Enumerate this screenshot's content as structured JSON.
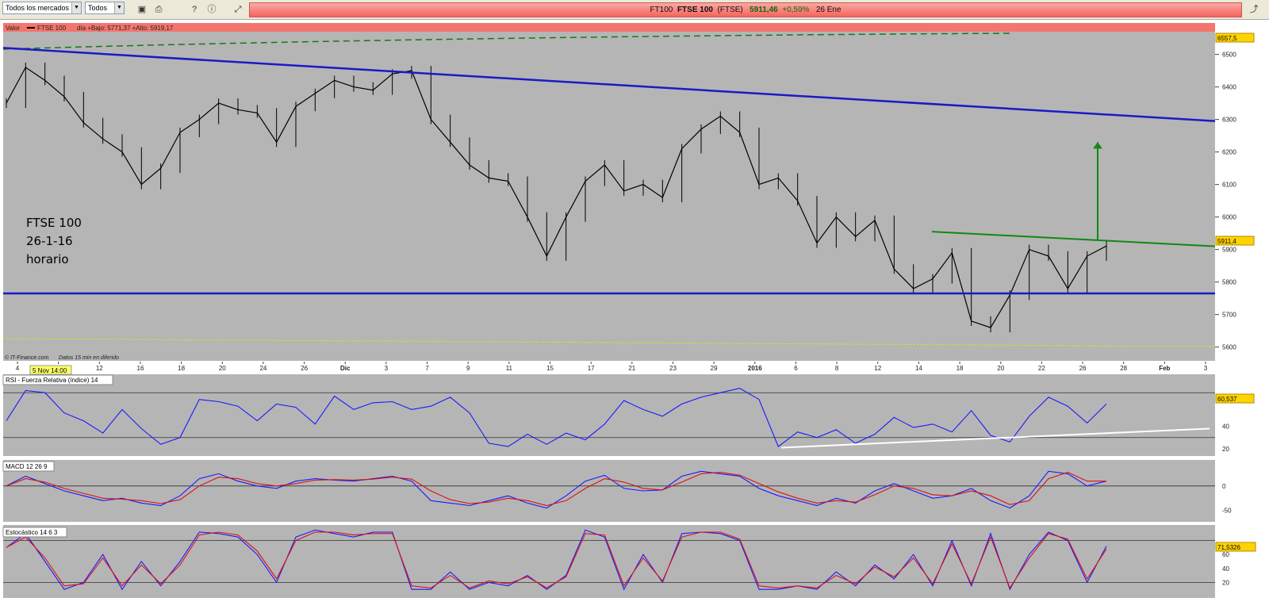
{
  "toolbar": {
    "market_select": "Todos los mercados",
    "type_select": "Todos",
    "ticker": {
      "code": "FT100",
      "name": "FTSE 100",
      "symbol": "(FTSE)",
      "price": "5911,46",
      "change": "+0,59%",
      "date": "26 Ene"
    }
  },
  "main_panel": {
    "legend": "Valor",
    "series_name": "FTSE 100",
    "day_range": "día +Bajo: 5771,37 +Alto: 5919,17",
    "annotation": [
      "FTSE 100",
      "26-1-16",
      "horario"
    ],
    "source": "© IT-Finance.com",
    "source_note": "Datos 15 min en diferido",
    "cursor_date": "5 Nov 14:00",
    "top_value": "6557,5",
    "last_value": "5911,4"
  },
  "rsi_panel": {
    "title": "RSI - Fuerza Relativa (índice) 14",
    "last_value": "60,537"
  },
  "macd_panel": {
    "title": "MACD 12 26 9"
  },
  "stoch_panel": {
    "title": "Estocástico 14 6 3",
    "last_value": "71,5326"
  },
  "chart_data": [
    {
      "type": "candlestick",
      "title": "FTSE 100",
      "x_ticks": [
        "4",
        "10",
        "12",
        "16",
        "18",
        "20",
        "24",
        "26",
        "Dic",
        "3",
        "7",
        "9",
        "11",
        "15",
        "17",
        "21",
        "23",
        "29",
        "2016",
        "6",
        "8",
        "12",
        "14",
        "18",
        "20",
        "22",
        "26",
        "28",
        "Feb",
        "3"
      ],
      "y_ticks": [
        5600,
        5700,
        5800,
        5900,
        6000,
        6100,
        6200,
        6300,
        6400,
        6500
      ],
      "ylim": [
        5570,
        6560
      ],
      "series": [
        {
          "name": "FTSE 100",
          "points": [
            [
              0,
              6350
            ],
            [
              1,
              6460
            ],
            [
              2,
              6420
            ],
            [
              3,
              6370
            ],
            [
              4,
              6290
            ],
            [
              5,
              6240
            ],
            [
              6,
              6200
            ],
            [
              7,
              6100
            ],
            [
              8,
              6150
            ],
            [
              9,
              6260
            ],
            [
              10,
              6300
            ],
            [
              11,
              6350
            ],
            [
              12,
              6330
            ],
            [
              13,
              6320
            ],
            [
              14,
              6230
            ],
            [
              15,
              6340
            ],
            [
              16,
              6380
            ],
            [
              17,
              6420
            ],
            [
              18,
              6400
            ],
            [
              19,
              6390
            ],
            [
              20,
              6440
            ],
            [
              21,
              6450
            ],
            [
              22,
              6300
            ],
            [
              23,
              6230
            ],
            [
              24,
              6160
            ],
            [
              25,
              6120
            ],
            [
              26,
              6110
            ],
            [
              27,
              6000
            ],
            [
              28,
              5880
            ],
            [
              29,
              6000
            ],
            [
              30,
              6110
            ],
            [
              31,
              6160
            ],
            [
              32,
              6080
            ],
            [
              33,
              6100
            ],
            [
              34,
              6060
            ],
            [
              35,
              6210
            ],
            [
              36,
              6270
            ],
            [
              37,
              6310
            ],
            [
              38,
              6260
            ],
            [
              39,
              6100
            ],
            [
              40,
              6120
            ],
            [
              41,
              6050
            ],
            [
              42,
              5920
            ],
            [
              43,
              6000
            ],
            [
              44,
              5940
            ],
            [
              45,
              5990
            ],
            [
              46,
              5840
            ],
            [
              47,
              5780
            ],
            [
              48,
              5810
            ],
            [
              49,
              5890
            ],
            [
              50,
              5680
            ],
            [
              51,
              5660
            ],
            [
              52,
              5760
            ],
            [
              53,
              5900
            ],
            [
              54,
              5880
            ],
            [
              55,
              5780
            ],
            [
              56,
              5880
            ],
            [
              57,
              5911
            ]
          ]
        }
      ],
      "lines": [
        {
          "name": "resistencia bajista",
          "color": "#1a1ac8",
          "from": [
            6520
          ],
          "to": [
            6295
          ]
        },
        {
          "name": "soporte",
          "color": "#1a1ac8",
          "level": 5765
        },
        {
          "name": "línea clavicular",
          "color": "#118811",
          "from": [
            5955
          ],
          "to": [
            5910
          ]
        },
        {
          "name": "objetivo",
          "color": "#118811",
          "from": [
            5930
          ],
          "to": [
            6230
          ]
        }
      ]
    },
    {
      "type": "line",
      "title": "RSI - Fuerza Relativa (índice) 14",
      "y_ticks": [
        20,
        40
      ],
      "ylim": [
        15,
        85
      ],
      "series": [
        {
          "name": "RSI",
          "color": "#1a1aff",
          "values": [
            45,
            72,
            70,
            52,
            45,
            34,
            55,
            38,
            24,
            30,
            64,
            62,
            58,
            45,
            60,
            57,
            42,
            67,
            55,
            61,
            62,
            55,
            58,
            66,
            52,
            25,
            22,
            33,
            24,
            34,
            28,
            42,
            63,
            55,
            49,
            60,
            66,
            70,
            74,
            64,
            22,
            35,
            30,
            37,
            25,
            33,
            48,
            39,
            42,
            35,
            54,
            32,
            26,
            49,
            66,
            58,
            43,
            60
          ]
        }
      ],
      "lines": [
        {
          "name": "soporte RSI",
          "color": "#ffffff",
          "from": [
            21
          ],
          "to": [
            38
          ]
        }
      ]
    },
    {
      "type": "line",
      "title": "MACD 12 26 9",
      "y_ticks": [
        0,
        -50
      ],
      "ylim": [
        -70,
        50
      ],
      "series": [
        {
          "name": "MACD",
          "color": "#1a1aff",
          "values": [
            0,
            20,
            5,
            -10,
            -20,
            -30,
            -25,
            -35,
            -40,
            -20,
            15,
            25,
            10,
            0,
            -5,
            10,
            15,
            12,
            10,
            15,
            20,
            10,
            -30,
            -35,
            -40,
            -30,
            -20,
            -35,
            -45,
            -20,
            10,
            22,
            -5,
            -10,
            -8,
            20,
            30,
            25,
            20,
            -5,
            -20,
            -30,
            -40,
            -25,
            -35,
            -10,
            5,
            -10,
            -25,
            -20,
            -5,
            -30,
            -45,
            -20,
            30,
            25,
            0,
            10
          ]
        },
        {
          "name": "Señal",
          "color": "#dd1111",
          "values": [
            0,
            15,
            8,
            -5,
            -15,
            -25,
            -27,
            -30,
            -36,
            -28,
            0,
            18,
            15,
            5,
            0,
            5,
            12,
            13,
            12,
            14,
            18,
            14,
            -10,
            -28,
            -36,
            -33,
            -25,
            -30,
            -40,
            -30,
            -5,
            15,
            8,
            -5,
            -8,
            8,
            25,
            28,
            22,
            5,
            -12,
            -25,
            -35,
            -30,
            -33,
            -18,
            0,
            -5,
            -18,
            -20,
            -10,
            -20,
            -38,
            -30,
            15,
            28,
            10,
            10
          ]
        }
      ]
    },
    {
      "type": "line",
      "title": "Estocástico 14 6 3",
      "y_ticks": [
        20,
        40,
        60
      ],
      "ylim": [
        0,
        100
      ],
      "series": [
        {
          "name": "%K",
          "color": "#1a1aff",
          "values": [
            70,
            90,
            50,
            10,
            20,
            60,
            10,
            50,
            15,
            50,
            92,
            90,
            85,
            60,
            20,
            85,
            95,
            90,
            85,
            92,
            92,
            10,
            10,
            35,
            10,
            20,
            15,
            30,
            10,
            30,
            95,
            85,
            10,
            60,
            20,
            90,
            92,
            90,
            80,
            10,
            10,
            15,
            10,
            35,
            15,
            45,
            25,
            60,
            15,
            80,
            15,
            90,
            10,
            60,
            92,
            80,
            20,
            72
          ]
        },
        {
          "name": "%D",
          "color": "#dd1111",
          "values": [
            70,
            85,
            55,
            15,
            18,
            55,
            15,
            45,
            18,
            45,
            88,
            92,
            88,
            65,
            25,
            80,
            92,
            92,
            88,
            90,
            90,
            15,
            12,
            30,
            12,
            22,
            18,
            28,
            12,
            28,
            90,
            88,
            15,
            55,
            22,
            85,
            92,
            92,
            82,
            15,
            12,
            15,
            12,
            30,
            18,
            42,
            28,
            55,
            18,
            75,
            18,
            85,
            12,
            55,
            90,
            82,
            25,
            68
          ]
        }
      ]
    }
  ]
}
